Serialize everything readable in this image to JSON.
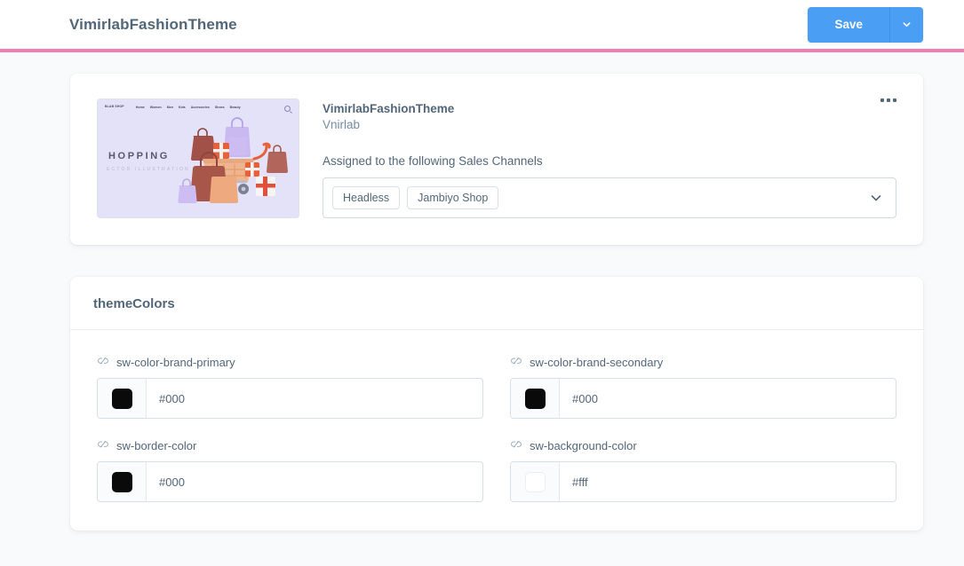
{
  "header": {
    "title": "VimirlabFashionTheme",
    "save_label": "Save",
    "save_caret_icon": "chevron-down-icon",
    "accent_color": "#f07fb4",
    "primary_color": "#4a9ef4"
  },
  "theme_card": {
    "preview": {
      "logo": "BLAB SHOP",
      "nav_items": [
        "Home",
        "Women",
        "Men",
        "Kids",
        "Accessories",
        "Shoes",
        "Beauty"
      ],
      "search_icon": "search-icon",
      "headline": "HOPPING",
      "subheadline": "ECTOR ILLUSTRATION",
      "background_color": "#e3e2f8"
    },
    "name": "VimirlabFashionTheme",
    "author": "Vnirlab",
    "assigned_label": "Assigned to the following Sales Channels",
    "channels": [
      "Headless",
      "Jambiyo Shop"
    ],
    "channel_caret_icon": "chevron-down-icon",
    "context_menu_icon": "more-options-icon"
  },
  "theme_colors": {
    "section_title": "themeColors",
    "fields": [
      {
        "label": "sw-color-brand-primary",
        "icon": "unlink-icon",
        "value": "#000",
        "swatch_color": "#0a0a0a"
      },
      {
        "label": "sw-color-brand-secondary",
        "icon": "unlink-icon",
        "value": "#000",
        "swatch_color": "#0a0a0a"
      },
      {
        "label": "sw-border-color",
        "icon": "unlink-icon",
        "value": "#000",
        "swatch_color": "#0a0a0a"
      },
      {
        "label": "sw-background-color",
        "icon": "unlink-icon",
        "value": "#fff",
        "swatch_color": "#ffffff"
      }
    ]
  }
}
